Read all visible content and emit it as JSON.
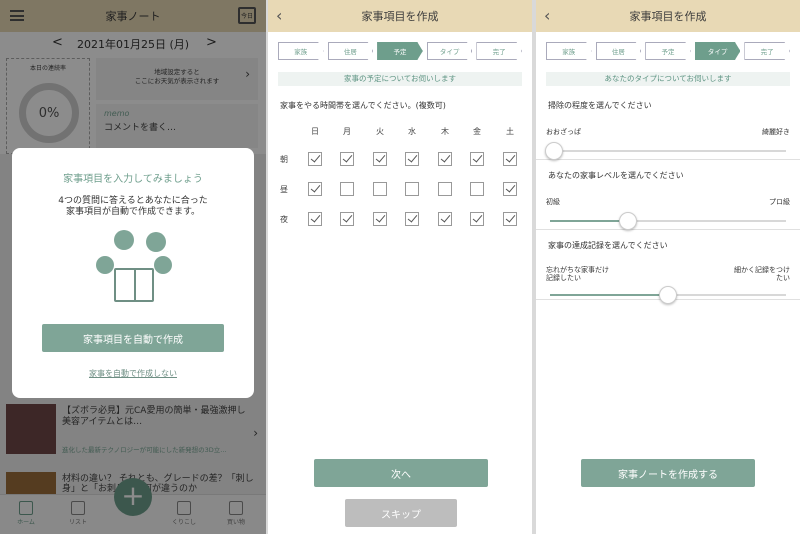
{
  "screen1": {
    "header_title": "家事ノート",
    "calendar_icon_text": "今日",
    "date": "2021年01月25日 (月)",
    "date_prev": "<",
    "date_next": ">",
    "streak_label": "本日の連続率",
    "percent": "0%",
    "weather_text_1": "地域設定すると",
    "weather_text_2": "ここにお天気が表示されます",
    "memo_title": "memo",
    "memo_placeholder": "コメントを書く…",
    "modal": {
      "title": "家事項目を入力してみましょう",
      "desc_1": "4つの質問に答えるとあなたに合った",
      "desc_2": "家事項目が自動で作成できます。",
      "cta": "家事項目を自動で作成",
      "skip": "家事を自動で作成しない"
    },
    "news": [
      {
        "title": "【ズボラ必見】元CA愛用の簡単・最強激押し美容アイテムとは…",
        "sub": "進化した最新テクノロジーが可能にした新発想の3D立..."
      },
      {
        "title": "材料の違い？ それとも、グレードの差？「刺し身」と「お刺身」は何が違うのか"
      }
    ],
    "tabs": [
      "ホーム",
      "リスト",
      "くりこし",
      "買い物"
    ]
  },
  "screen2": {
    "header_title": "家事項目を作成",
    "steps": [
      "家族",
      "住居",
      "予定",
      "タイプ",
      "完了"
    ],
    "active_step": 2,
    "subtitle": "家事の予定についてお伺いします",
    "question": "家事をやる時間帯を選んでください。(複数可)",
    "days": [
      "日",
      "月",
      "火",
      "水",
      "木",
      "金",
      "土"
    ],
    "rows": [
      {
        "label": "朝",
        "checked": [
          true,
          true,
          true,
          true,
          true,
          true,
          true
        ]
      },
      {
        "label": "昼",
        "checked": [
          true,
          false,
          false,
          false,
          false,
          false,
          true
        ]
      },
      {
        "label": "夜",
        "checked": [
          true,
          true,
          true,
          true,
          true,
          true,
          true
        ]
      }
    ],
    "next": "次へ",
    "skip": "スキップ"
  },
  "screen3": {
    "header_title": "家事項目を作成",
    "steps": [
      "家族",
      "住居",
      "予定",
      "タイプ",
      "完了"
    ],
    "active_step": 3,
    "subtitle": "あなたのタイプについてお伺いします",
    "questions": [
      {
        "q": "掃除の程度を選んでください",
        "left": "おおざっぱ",
        "right": "綺麗好き",
        "value": 0.0
      },
      {
        "q": "あなたの家事レベルを選んでください",
        "left": "初級",
        "right": "プロ級",
        "value": 0.33
      },
      {
        "q": "家事の達成記録を選んでください",
        "left": "忘れがちな家事だけ記録したい",
        "right": "細かく記録をつけたい",
        "value": 0.5
      }
    ],
    "create": "家事ノートを作成する"
  },
  "colors": {
    "accent": "#6e9e8c",
    "header": "#e8d9b5",
    "button": "#7fa597",
    "disabled": "#bdbdbd"
  }
}
